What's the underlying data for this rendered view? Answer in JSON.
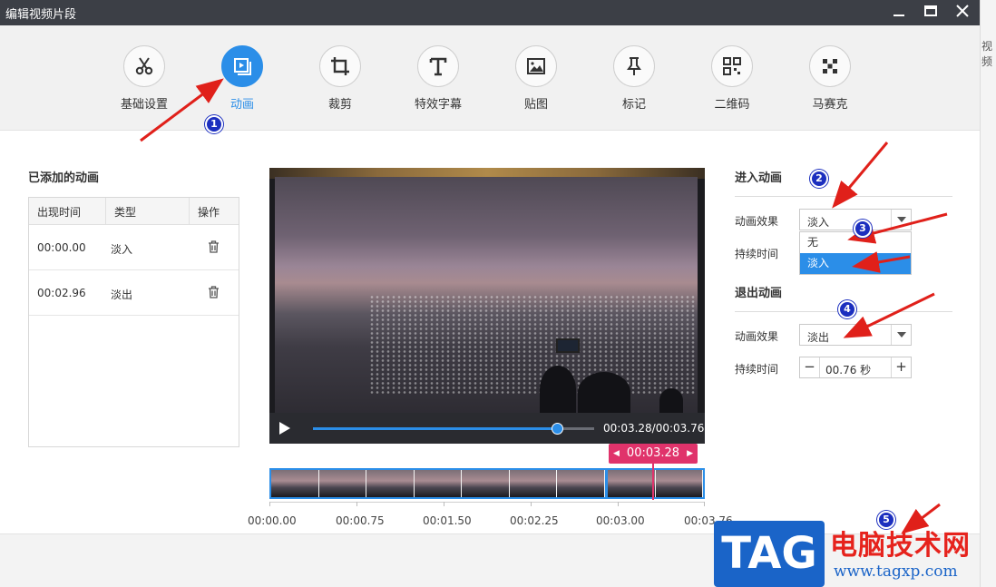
{
  "window": {
    "title": "编辑视频片段",
    "edge_text": "视频"
  },
  "toolbar": {
    "items": [
      {
        "label": "基础设置",
        "icon": "scissors-icon"
      },
      {
        "label": "动画",
        "icon": "play-frame-icon",
        "active": true
      },
      {
        "label": "裁剪",
        "icon": "crop-icon"
      },
      {
        "label": "特效字幕",
        "icon": "text-icon"
      },
      {
        "label": "贴图",
        "icon": "image-icon"
      },
      {
        "label": "标记",
        "icon": "pin-icon"
      },
      {
        "label": "二维码",
        "icon": "qrcode-icon"
      },
      {
        "label": "马赛克",
        "icon": "mosaic-icon"
      }
    ]
  },
  "added": {
    "title": "已添加的动画",
    "columns": [
      "出现时间",
      "类型",
      "操作"
    ],
    "rows": [
      {
        "time": "00:00.00",
        "type": "淡入"
      },
      {
        "time": "00:02.96",
        "type": "淡出"
      }
    ]
  },
  "player": {
    "time": "00:03.28/00:03.76",
    "progress_fraction": 0.87,
    "marker": "00:03.28"
  },
  "timeline": {
    "labels": [
      "00:00.00",
      "00:00.75",
      "00:01.50",
      "00:02.25",
      "00:03.00",
      "00:03.76"
    ]
  },
  "enter": {
    "title": "进入动画",
    "effect_label": "动画效果",
    "effect_value": "淡入",
    "duration_label": "持续时间",
    "options": [
      "无",
      "淡入"
    ]
  },
  "exit": {
    "title": "退出动画",
    "effect_label": "动画效果",
    "effect_value": "淡出",
    "duration_label": "持续时间",
    "duration_value": "00.76 秒"
  },
  "annotations": [
    "1",
    "2",
    "3",
    "4",
    "5"
  ],
  "watermark": {
    "logo": "TAG",
    "name": "电脑技术网",
    "url": "www.tagxp.com"
  },
  "colors": {
    "accent": "#2b8ee8",
    "marker": "#e0336b",
    "arrow": "#e0201a",
    "badge": "#1c2fbf"
  }
}
